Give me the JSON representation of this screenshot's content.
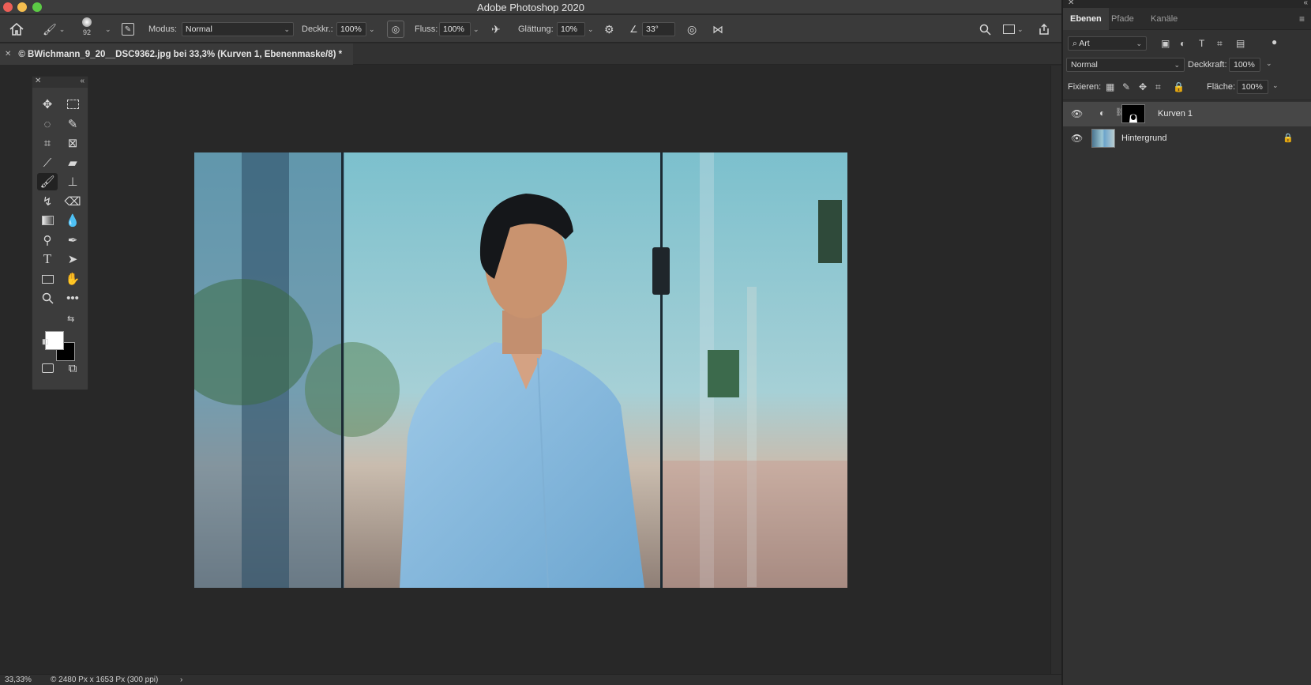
{
  "window": {
    "title": "Adobe Photoshop 2020"
  },
  "options_bar": {
    "brush_size": "92",
    "mode_label": "Modus:",
    "mode_value": "Normal",
    "opacity_label": "Deckkr.:",
    "opacity_value": "100%",
    "flow_label": "Fluss:",
    "flow_value": "100%",
    "smoothing_label": "Glättung:",
    "smoothing_value": "10%",
    "angle_value": "33°"
  },
  "document": {
    "tab_title": "© BWichmann_9_20__DSC9362.jpg bei 33,3% (Kurven 1, Ebenenmaske/8) *"
  },
  "status": {
    "zoom": "33,33%",
    "doc_info": "© 2480 Px x 1653 Px (300 ppi)",
    "arrow": "›"
  },
  "panel": {
    "tabs": [
      "Ebenen",
      "Pfade",
      "Kanäle"
    ],
    "filter_value": "Art",
    "blend_value": "Normal",
    "opacity_label": "Deckkraft:",
    "opacity_value": "100%",
    "lock_label": "Fixieren:",
    "fill_label": "Fläche:",
    "fill_value": "100%",
    "layers": [
      {
        "name": "Kurven 1",
        "selected": true
      },
      {
        "name": "Hintergrund",
        "selected": false
      }
    ]
  },
  "colors": {
    "foreground": "#ffffff",
    "background": "#000000"
  }
}
